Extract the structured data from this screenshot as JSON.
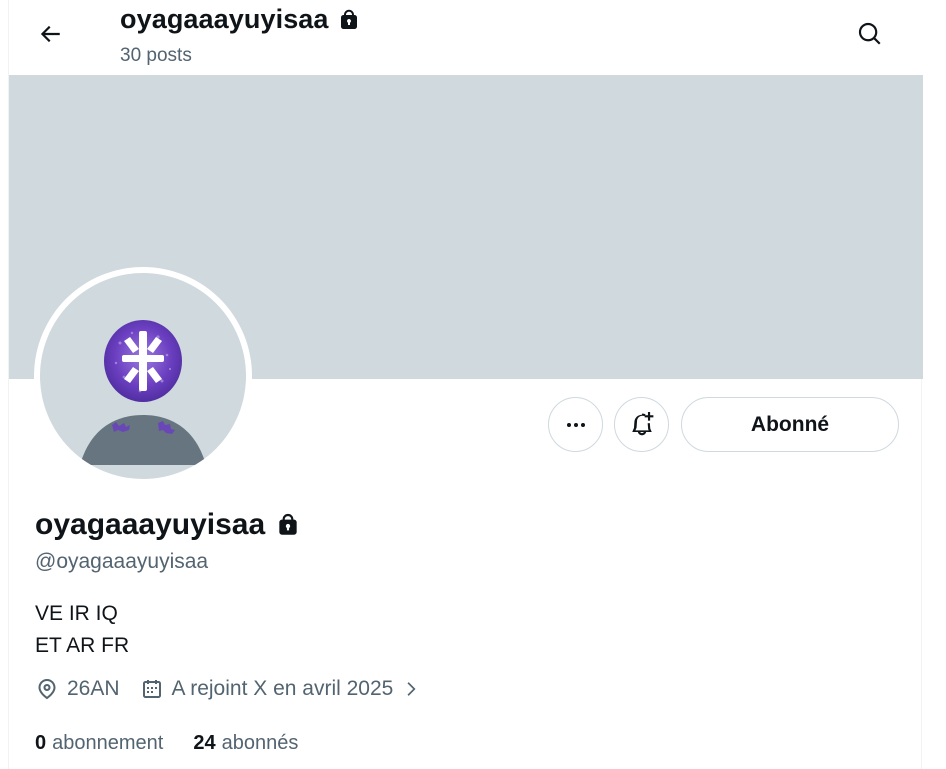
{
  "header": {
    "back_icon": "arrow-left-icon",
    "title": "oyagaaayuyisaa",
    "posts_count": "30 posts",
    "search_icon": "search-icon",
    "protected_icon": "lock-icon"
  },
  "banner": {
    "color": "#cfd9de"
  },
  "avatar": {
    "icon": "default-avatar-icon",
    "accent": "#6b3fc0"
  },
  "actions": {
    "more_icon": "more-dots-icon",
    "notify_icon": "bell-plus-icon",
    "follow_label": "Abonné"
  },
  "profile": {
    "display_name": "oyagaaayuyisaa",
    "handle": "@oyagaaayuyisaa",
    "bio_line1": "VE IR IQ",
    "bio_line2": "ET AR FR",
    "location": "26AN",
    "location_icon": "location-pin-icon",
    "joined": "A rejoint X en avril 2025",
    "calendar_icon": "calendar-icon",
    "chevron_icon": "chevron-right-icon"
  },
  "stats": {
    "following_count": "0",
    "following_label": "abonnement",
    "followers_count": "24",
    "followers_label": "abonnés"
  },
  "colors": {
    "text_primary": "#0f1419",
    "text_secondary": "#536471",
    "border": "#cfd9de"
  }
}
